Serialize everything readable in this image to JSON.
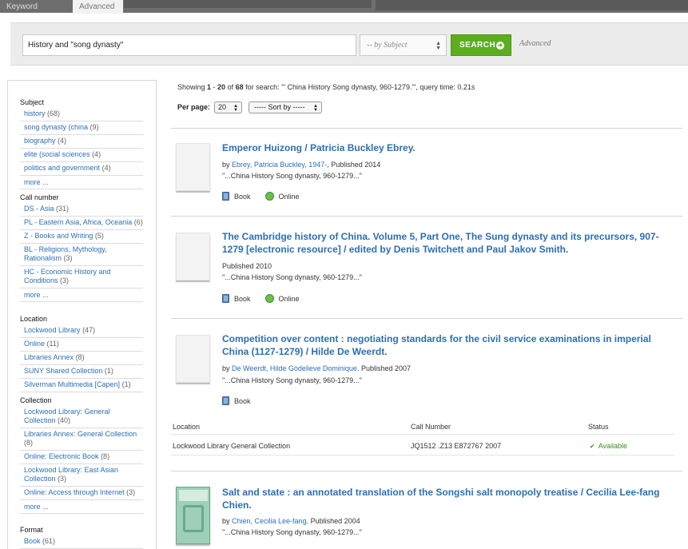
{
  "top_tabs": [
    "Keyword",
    "Advanced"
  ],
  "search": {
    "query": "History and \"song dynasty\"",
    "field": "-- by Subject",
    "button_label": "SEARCH",
    "advanced_label": "Advanced"
  },
  "summary": {
    "prefix": "Showing ",
    "range_start": "1",
    "range_sep": " - ",
    "range_end": "20",
    "of": " of ",
    "total": "68",
    "suffix": " for search: '\" China History Song dynasty, 960-1279.\"', query time: 0.21s"
  },
  "controls": {
    "per_page_label": "Per page:",
    "per_page_value": "20",
    "sort_label": "----- Sort by -----"
  },
  "facets": {
    "subject": {
      "title": "Subject",
      "items": [
        {
          "label": "history",
          "count": "(68)"
        },
        {
          "label": "song dynasty (china",
          "count": "(9)"
        },
        {
          "label": "biography",
          "count": "(4)"
        },
        {
          "label": "elite (social sciences",
          "count": "(4)"
        },
        {
          "label": "politics and government",
          "count": "(4)"
        }
      ],
      "more": "more ..."
    },
    "call_number": {
      "title": "Call number",
      "items": [
        {
          "label": "DS - Asia",
          "count": "(31)"
        },
        {
          "label": "PL - Eastern Asia, Africa, Oceania",
          "count": "(6)"
        },
        {
          "label": "Z - Books and Writing",
          "count": "(5)"
        },
        {
          "label": "BL - Religions, Mythology, Rationalism",
          "count": "(3)"
        },
        {
          "label": "HC - Economic History and Conditions",
          "count": "(3)"
        }
      ],
      "more": "more ..."
    },
    "location": {
      "title": "Location",
      "items": [
        {
          "label": "Lockwood Library",
          "count": "(47)"
        },
        {
          "label": "Online",
          "count": "(11)"
        },
        {
          "label": "Libraries Annex",
          "count": "(8)"
        },
        {
          "label": "SUNY Shared Collection",
          "count": "(1)"
        },
        {
          "label": "Silverman Multimedia [Capen]",
          "count": "(1)"
        }
      ]
    },
    "collection": {
      "title": "Collection",
      "items": [
        {
          "label": "Lockwood Library: General Collection",
          "count": "(40)"
        },
        {
          "label": "Libraries Annex: General Collection",
          "count": "(8)"
        },
        {
          "label": "Online: Electronic Book",
          "count": "(8)"
        },
        {
          "label": "Lockwood Library: East Asian Collection",
          "count": "(3)"
        },
        {
          "label": "Online: Access through Internet",
          "count": "(3)"
        }
      ],
      "more": "more ..."
    },
    "format": {
      "title": "Format",
      "items": [
        {
          "label": "Book",
          "count": "(61)"
        }
      ]
    }
  },
  "results": [
    {
      "title": "Emperor Huizong / Patricia Buckley Ebrey.",
      "by": "by ",
      "author": "Ebrey, Patricia Buckley, 1947-",
      "published": ", Published 2014",
      "snippet": "\"...China History Song dynasty, 960-1279...\"",
      "format": "Book",
      "online": "Online"
    },
    {
      "title": "The Cambridge history of China. Volume 5, Part One, The Sung dynasty and its precursors, 907-1279 [electronic resource] / edited by Denis Twitchett and Paul Jakov Smith.",
      "published": "Published 2010",
      "snippet": "\"...China History Song dynasty, 960-1279...\"",
      "format": "Book",
      "online": "Online"
    },
    {
      "title": "Competition over content : negotiating standards for the civil service examinations in imperial China (1127-1279) / Hilde De Weerdt.",
      "by": "by ",
      "author": "De Weerdt, Hilde Godelieve Dominique",
      "published": ". Published 2007",
      "snippet": "\"...China History Song dynasty, 960-1279...\"",
      "format": "Book",
      "holdings": {
        "headers": [
          "Location",
          "Call Number",
          "Status"
        ],
        "row": {
          "location": "Lockwood Library General Collection",
          "call_number": "JQ1512 .Z13 E872767 2007",
          "status": "Available"
        }
      }
    },
    {
      "title": "Salt and state : an annotated translation of the Songshi salt monopoly treatise / Cecilia Lee-fang Chien.",
      "by": "by ",
      "author": "Chien, Cecilia Lee-fang",
      "published": ". Published 2004",
      "snippet": "\"...China History Song dynasty, 960-1279...\""
    }
  ],
  "icons": {
    "book": "book-icon",
    "online": "globe-icon",
    "available": "check-icon",
    "go": "arrow-right-icon"
  },
  "colors": {
    "link": "#2c6fb4",
    "search_button": "#5cae1f",
    "available": "#3a8f24"
  }
}
